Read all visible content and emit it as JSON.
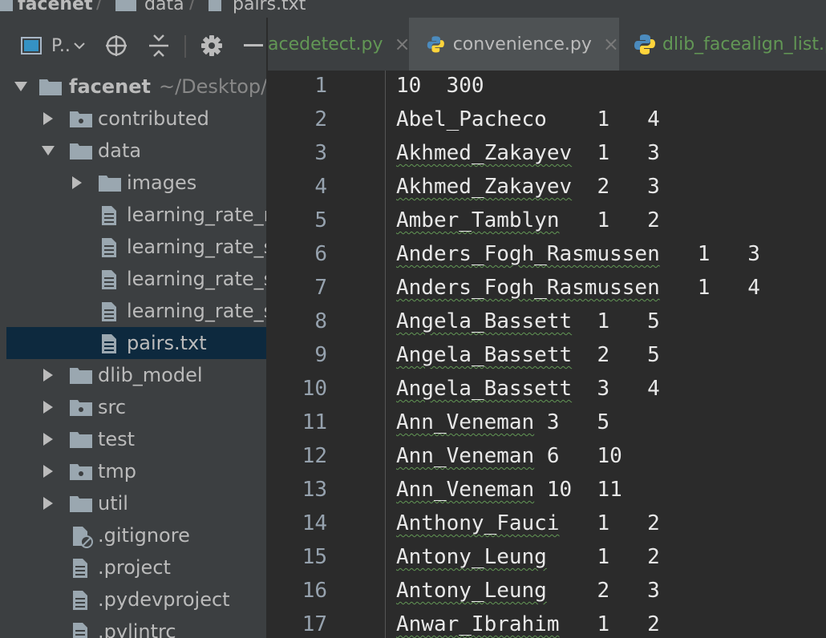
{
  "breadcrumb": [
    "facenet",
    "data",
    "pairs.txt"
  ],
  "project_toolbar": {
    "view_label": "P..",
    "icons": [
      "project-view-icon",
      "dropdown-icon",
      "locate-icon",
      "collapse-icon",
      "gear-icon",
      "hide-icon"
    ]
  },
  "tree": {
    "root": {
      "label": "facenet",
      "hint": "~/Desktop/"
    },
    "items": [
      {
        "label": "contributed",
        "icon": "folder-icon",
        "expanded": false
      },
      {
        "label": "data",
        "icon": "folder-icon",
        "expanded": true
      },
      {
        "label": "images",
        "icon": "folder-icon",
        "expanded": false
      },
      {
        "label": "learning_rate_r",
        "icon": "text-file-icon"
      },
      {
        "label": "learning_rate_s",
        "icon": "text-file-icon"
      },
      {
        "label": "learning_rate_s",
        "icon": "text-file-icon"
      },
      {
        "label": "learning_rate_s",
        "icon": "text-file-icon"
      },
      {
        "label": "pairs.txt",
        "icon": "text-file-icon",
        "selected": true
      },
      {
        "label": "dlib_model",
        "icon": "folder-icon",
        "expanded": false
      },
      {
        "label": "src",
        "icon": "folder-icon",
        "expanded": false
      },
      {
        "label": "test",
        "icon": "folder-icon",
        "expanded": false
      },
      {
        "label": "tmp",
        "icon": "folder-icon",
        "expanded": false
      },
      {
        "label": "util",
        "icon": "folder-icon",
        "expanded": false
      },
      {
        "label": ".gitignore",
        "icon": "gitignore-file-icon"
      },
      {
        "label": ".project",
        "icon": "text-file-icon"
      },
      {
        "label": ".pydevproject",
        "icon": "text-file-icon"
      },
      {
        "label": ".pylintrc",
        "icon": "text-file-icon"
      }
    ]
  },
  "tabs": [
    {
      "label": "acedetect.py",
      "close": "×",
      "color": "#629755"
    },
    {
      "label": "convenience.py",
      "close": "×",
      "color": "#bbbbbb",
      "active": true
    },
    {
      "label": "dlib_facealign_list.p",
      "color": "#629755"
    }
  ],
  "editor": {
    "lines": [
      {
        "n": "1",
        "name": "10",
        "rest": "  300",
        "typo": false
      },
      {
        "n": "2",
        "name": "Abel_Pacheco",
        "rest": "    1   4",
        "typo": false
      },
      {
        "n": "3",
        "name": "Akhmed_Zakayev",
        "rest": "  1   3",
        "typo": true
      },
      {
        "n": "4",
        "name": "Akhmed_Zakayev",
        "rest": "  2   3",
        "typo": true
      },
      {
        "n": "5",
        "name": "Amber_Tamblyn",
        "rest": "   1   2",
        "typo": true
      },
      {
        "n": "6",
        "name": "Anders_Fogh_Rasmussen",
        "rest": "   1   3",
        "typo": true
      },
      {
        "n": "7",
        "name": "Anders_Fogh_Rasmussen",
        "rest": "   1   4",
        "typo": true
      },
      {
        "n": "8",
        "name": "Angela_Bassett",
        "rest": "  1   5",
        "typo": true
      },
      {
        "n": "9",
        "name": "Angela_Bassett",
        "rest": "  2   5",
        "typo": true
      },
      {
        "n": "10",
        "name": "Angela_Bassett",
        "rest": "  3   4",
        "typo": true
      },
      {
        "n": "11",
        "name": "Ann_Veneman",
        "rest": " 3   5",
        "typo": true
      },
      {
        "n": "12",
        "name": "Ann_Veneman",
        "rest": " 6   10",
        "typo": true
      },
      {
        "n": "13",
        "name": "Ann_Veneman",
        "rest": " 10  11",
        "typo": true
      },
      {
        "n": "14",
        "name": "Anthony_Fauci",
        "rest": "   1   2",
        "typo": true
      },
      {
        "n": "15",
        "name": "Antony_Leung",
        "rest": "    1   2",
        "typo": true
      },
      {
        "n": "16",
        "name": "Antony_Leung",
        "rest": "    2   3",
        "typo": true
      },
      {
        "n": "17",
        "name": "Anwar_Ibrahim",
        "rest": "   1   2",
        "typo": true
      }
    ]
  },
  "colors": {
    "panel_bg": "#3c3f41",
    "editor_bg": "#2b2b2b",
    "selection": "#0d293e",
    "modified_tab": "#629755",
    "text": "#bbbbbb"
  }
}
